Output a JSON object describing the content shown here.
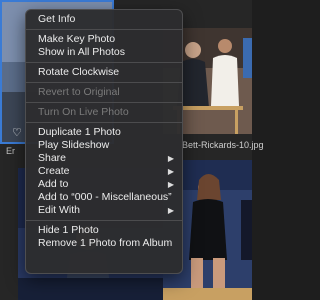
{
  "context_menu": {
    "groups": [
      {
        "items": [
          {
            "label": "Get Info",
            "enabled": true,
            "submenu": false
          }
        ]
      },
      {
        "items": [
          {
            "label": "Make Key Photo",
            "enabled": true,
            "submenu": false
          },
          {
            "label": "Show in All Photos",
            "enabled": true,
            "submenu": false
          }
        ]
      },
      {
        "items": [
          {
            "label": "Rotate Clockwise",
            "enabled": true,
            "submenu": false
          }
        ]
      },
      {
        "items": [
          {
            "label": "Revert to Original",
            "enabled": false,
            "submenu": false
          }
        ]
      },
      {
        "items": [
          {
            "label": "Turn On Live Photo",
            "enabled": false,
            "submenu": false
          }
        ]
      },
      {
        "items": [
          {
            "label": "Duplicate 1 Photo",
            "enabled": true,
            "submenu": false
          },
          {
            "label": "Play Slideshow",
            "enabled": true,
            "submenu": false
          },
          {
            "label": "Share",
            "enabled": true,
            "submenu": true
          },
          {
            "label": "Create",
            "enabled": true,
            "submenu": true
          },
          {
            "label": "Add to",
            "enabled": true,
            "submenu": true
          },
          {
            "label": "Add to “000 - Miscellaneous”",
            "enabled": true,
            "submenu": false
          },
          {
            "label": "Edit With",
            "enabled": true,
            "submenu": true
          }
        ]
      },
      {
        "items": [
          {
            "label": "Hide 1 Photo",
            "enabled": true,
            "submenu": false
          },
          {
            "label": "Remove 1 Photo from Album",
            "enabled": true,
            "submenu": false
          }
        ]
      }
    ]
  },
  "grid": {
    "caption_left": "Er",
    "caption_right": "Bett-Rickards-10.jpg",
    "heart_glyph": "♡"
  },
  "colors": {
    "selection_border": "#3a7bd5",
    "menu_background": "#2c2c2e",
    "menu_text": "#ececec",
    "disabled_text": "#7a7a7a"
  }
}
